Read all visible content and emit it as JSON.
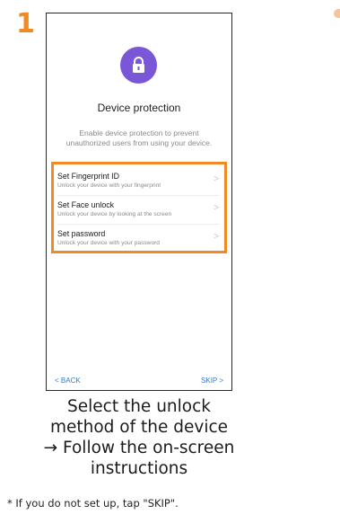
{
  "step": {
    "number": "1"
  },
  "screen": {
    "title": "Device protection",
    "description_line1": "Enable device protection to prevent",
    "description_line2": "unauthorized users from using your device.",
    "options": [
      {
        "label": "Set Fingerprint ID",
        "sub": "Unlock your device with your fingerprint",
        "chevron": ">"
      },
      {
        "label": "Set Face unlock",
        "sub": "Unlock your device by looking at the screen",
        "chevron": ">"
      },
      {
        "label": "Set password",
        "sub": "Unlock your device with your password",
        "chevron": ">"
      }
    ],
    "back_label": "< BACK",
    "skip_label": "SKIP >",
    "icon": "lock-icon",
    "accent_color": "#7a57d6",
    "highlight_color": "#f08a24",
    "link_color": "#2f7bd8"
  },
  "caption": {
    "line1": "Select the unlock",
    "line2": "method of the device",
    "line3": "→ Follow the on-screen",
    "line4": "instructions",
    "note": "* If you do not set up, tap \"SKIP\"."
  }
}
